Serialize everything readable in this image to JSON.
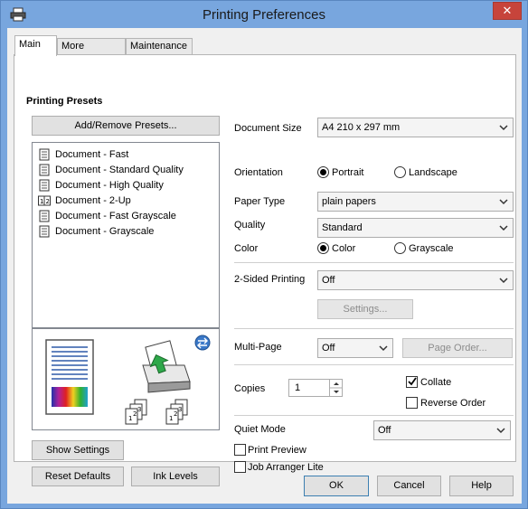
{
  "window": {
    "title": "Printing Preferences",
    "close": "✕"
  },
  "tabs": [
    {
      "label": "Main"
    },
    {
      "label": "More Options"
    },
    {
      "label": "Maintenance"
    }
  ],
  "presets": {
    "heading": "Printing Presets",
    "add_remove": "Add/Remove Presets...",
    "items": [
      {
        "label": "Document - Fast",
        "icon": "document-icon"
      },
      {
        "label": "Document - Standard Quality",
        "icon": "document-icon"
      },
      {
        "label": "Document - High Quality",
        "icon": "document-icon"
      },
      {
        "label": "Document - 2-Up",
        "icon": "two-up-icon"
      },
      {
        "label": "Document - Fast Grayscale",
        "icon": "document-icon"
      },
      {
        "label": "Document - Grayscale",
        "icon": "document-icon"
      }
    ]
  },
  "preview": {
    "pages_a": [
      "1",
      "2",
      "3"
    ],
    "pages_b": [
      "1",
      "2",
      "3"
    ]
  },
  "left_buttons": {
    "show_settings": "Show Settings",
    "reset_defaults": "Reset Defaults",
    "ink_levels": "Ink Levels"
  },
  "settings": {
    "document_size": {
      "label": "Document Size",
      "value": "A4 210 x 297 mm"
    },
    "orientation": {
      "label": "Orientation",
      "options": [
        "Portrait",
        "Landscape"
      ],
      "selected": "Portrait"
    },
    "paper_type": {
      "label": "Paper Type",
      "value": "plain papers"
    },
    "quality": {
      "label": "Quality",
      "value": "Standard"
    },
    "color": {
      "label": "Color",
      "options": [
        "Color",
        "Grayscale"
      ],
      "selected": "Color"
    },
    "two_sided": {
      "label": "2-Sided Printing",
      "value": "Off",
      "settings_button": "Settings..."
    },
    "multi_page": {
      "label": "Multi-Page",
      "value": "Off",
      "page_order_button": "Page Order..."
    },
    "copies": {
      "label": "Copies",
      "value": "1",
      "collate": "Collate",
      "collate_checked": true,
      "reverse_order": "Reverse Order",
      "reverse_checked": false
    },
    "quiet_mode": {
      "label": "Quiet Mode",
      "value": "Off"
    },
    "print_preview": {
      "label": "Print Preview",
      "checked": false
    },
    "job_arranger": {
      "label": "Job Arranger Lite",
      "checked": false
    }
  },
  "footer": {
    "ok": "OK",
    "cancel": "Cancel",
    "help": "Help"
  }
}
